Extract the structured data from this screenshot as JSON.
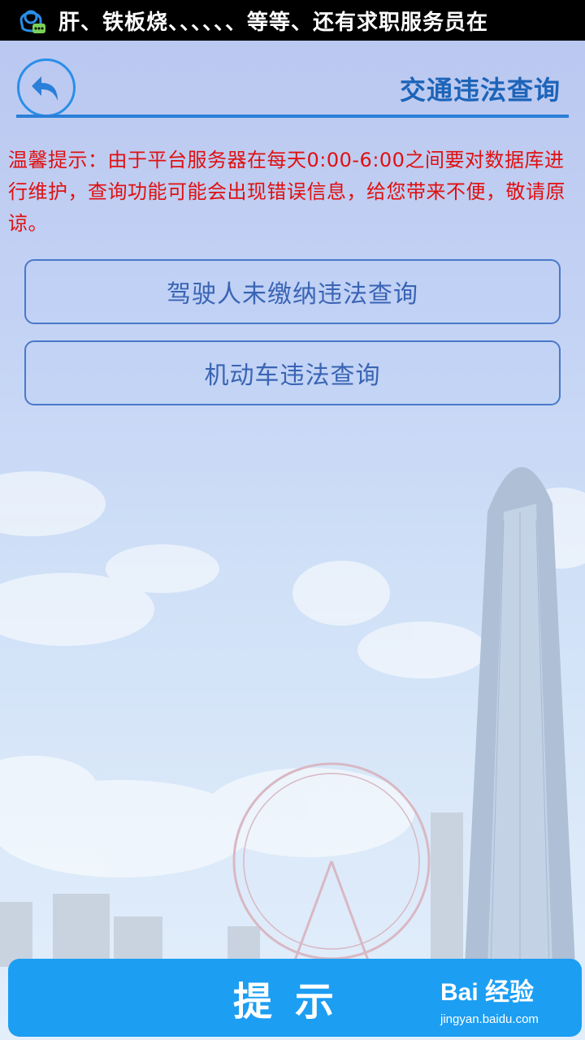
{
  "status_bar": {
    "notification_text": "肝、铁板烧、、、、、、等等、还有求职服务员在",
    "icon": "chat-notification-icon"
  },
  "header": {
    "back_icon": "back-arrow-icon",
    "title": "交通违法查询"
  },
  "notice": {
    "text": "温馨提示：由于平台服务器在每天0:00-6:00之间要对数据库进行维护，查询功能可能会出现错误信息，给您带来不便，敬请原谅。"
  },
  "buttons": {
    "driver_query": "驾驶人未缴纳违法查询",
    "vehicle_query": "机动车违法查询"
  },
  "bottom": {
    "tip_label": "提示"
  },
  "watermark": {
    "logo": "Bai 经验",
    "url": "jingyan.baidu.com"
  },
  "colors": {
    "accent": "#2a8ee8",
    "title": "#1d64b8",
    "notice": "#e01010",
    "tip_button": "#1c9ef3"
  }
}
